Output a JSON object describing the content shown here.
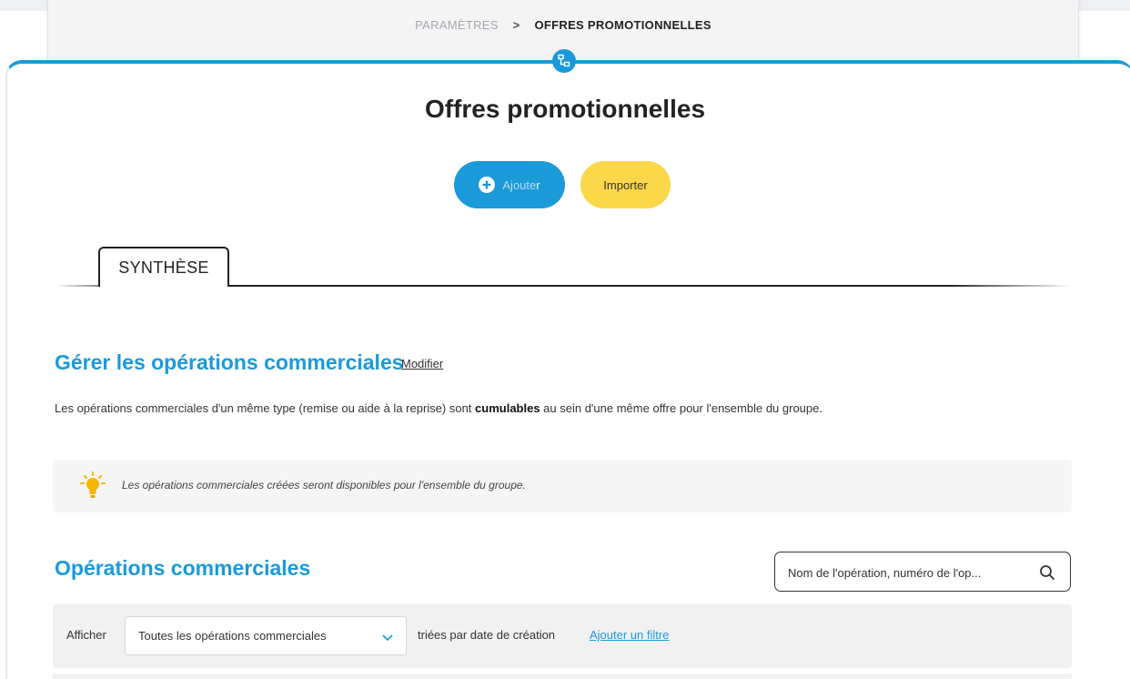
{
  "breadcrumb": {
    "parent": "PARAMÈTRES",
    "separator": ">",
    "current": "OFFRES PROMOTIONNELLES"
  },
  "page": {
    "title": "Offres promotionnelles"
  },
  "actions": {
    "add_label_faded": "Ajoute",
    "add_label_end": "r",
    "import_label": "Importer"
  },
  "tabs": [
    {
      "label": "SYNTHÈSE",
      "active": true
    }
  ],
  "manage_section": {
    "title": "Gérer les opérations commerciales",
    "edit_link": "Modifier",
    "description_before": "Les opérations commerciales d'un même type (remise ou aide à la reprise) sont ",
    "description_bold": "cumulables",
    "description_after": " au sein d'une même offre pour l'ensemble du groupe.",
    "info": "Les opérations commerciales créées seront disponibles pour l'ensemble du groupe."
  },
  "operations": {
    "title": "Opérations commerciales",
    "search_placeholder": "Nom de l'opération, numéro de l'op...",
    "filter": {
      "show_label": "Afficher",
      "selected_value": "Toutes les opérations commerciales",
      "sorted_text": "triées par date de création",
      "add_filter_link": "Ajouter un filtre"
    }
  },
  "colors": {
    "accent": "#1a9ad9",
    "secondary_button": "#fbd84a",
    "panel_bg": "#f4f4f5"
  },
  "icons": {
    "section_badge": "hierarchy-icon",
    "add": "plus-circle-icon",
    "info": "lightbulb-icon",
    "search": "search-icon",
    "select": "chevron-down-icon"
  }
}
